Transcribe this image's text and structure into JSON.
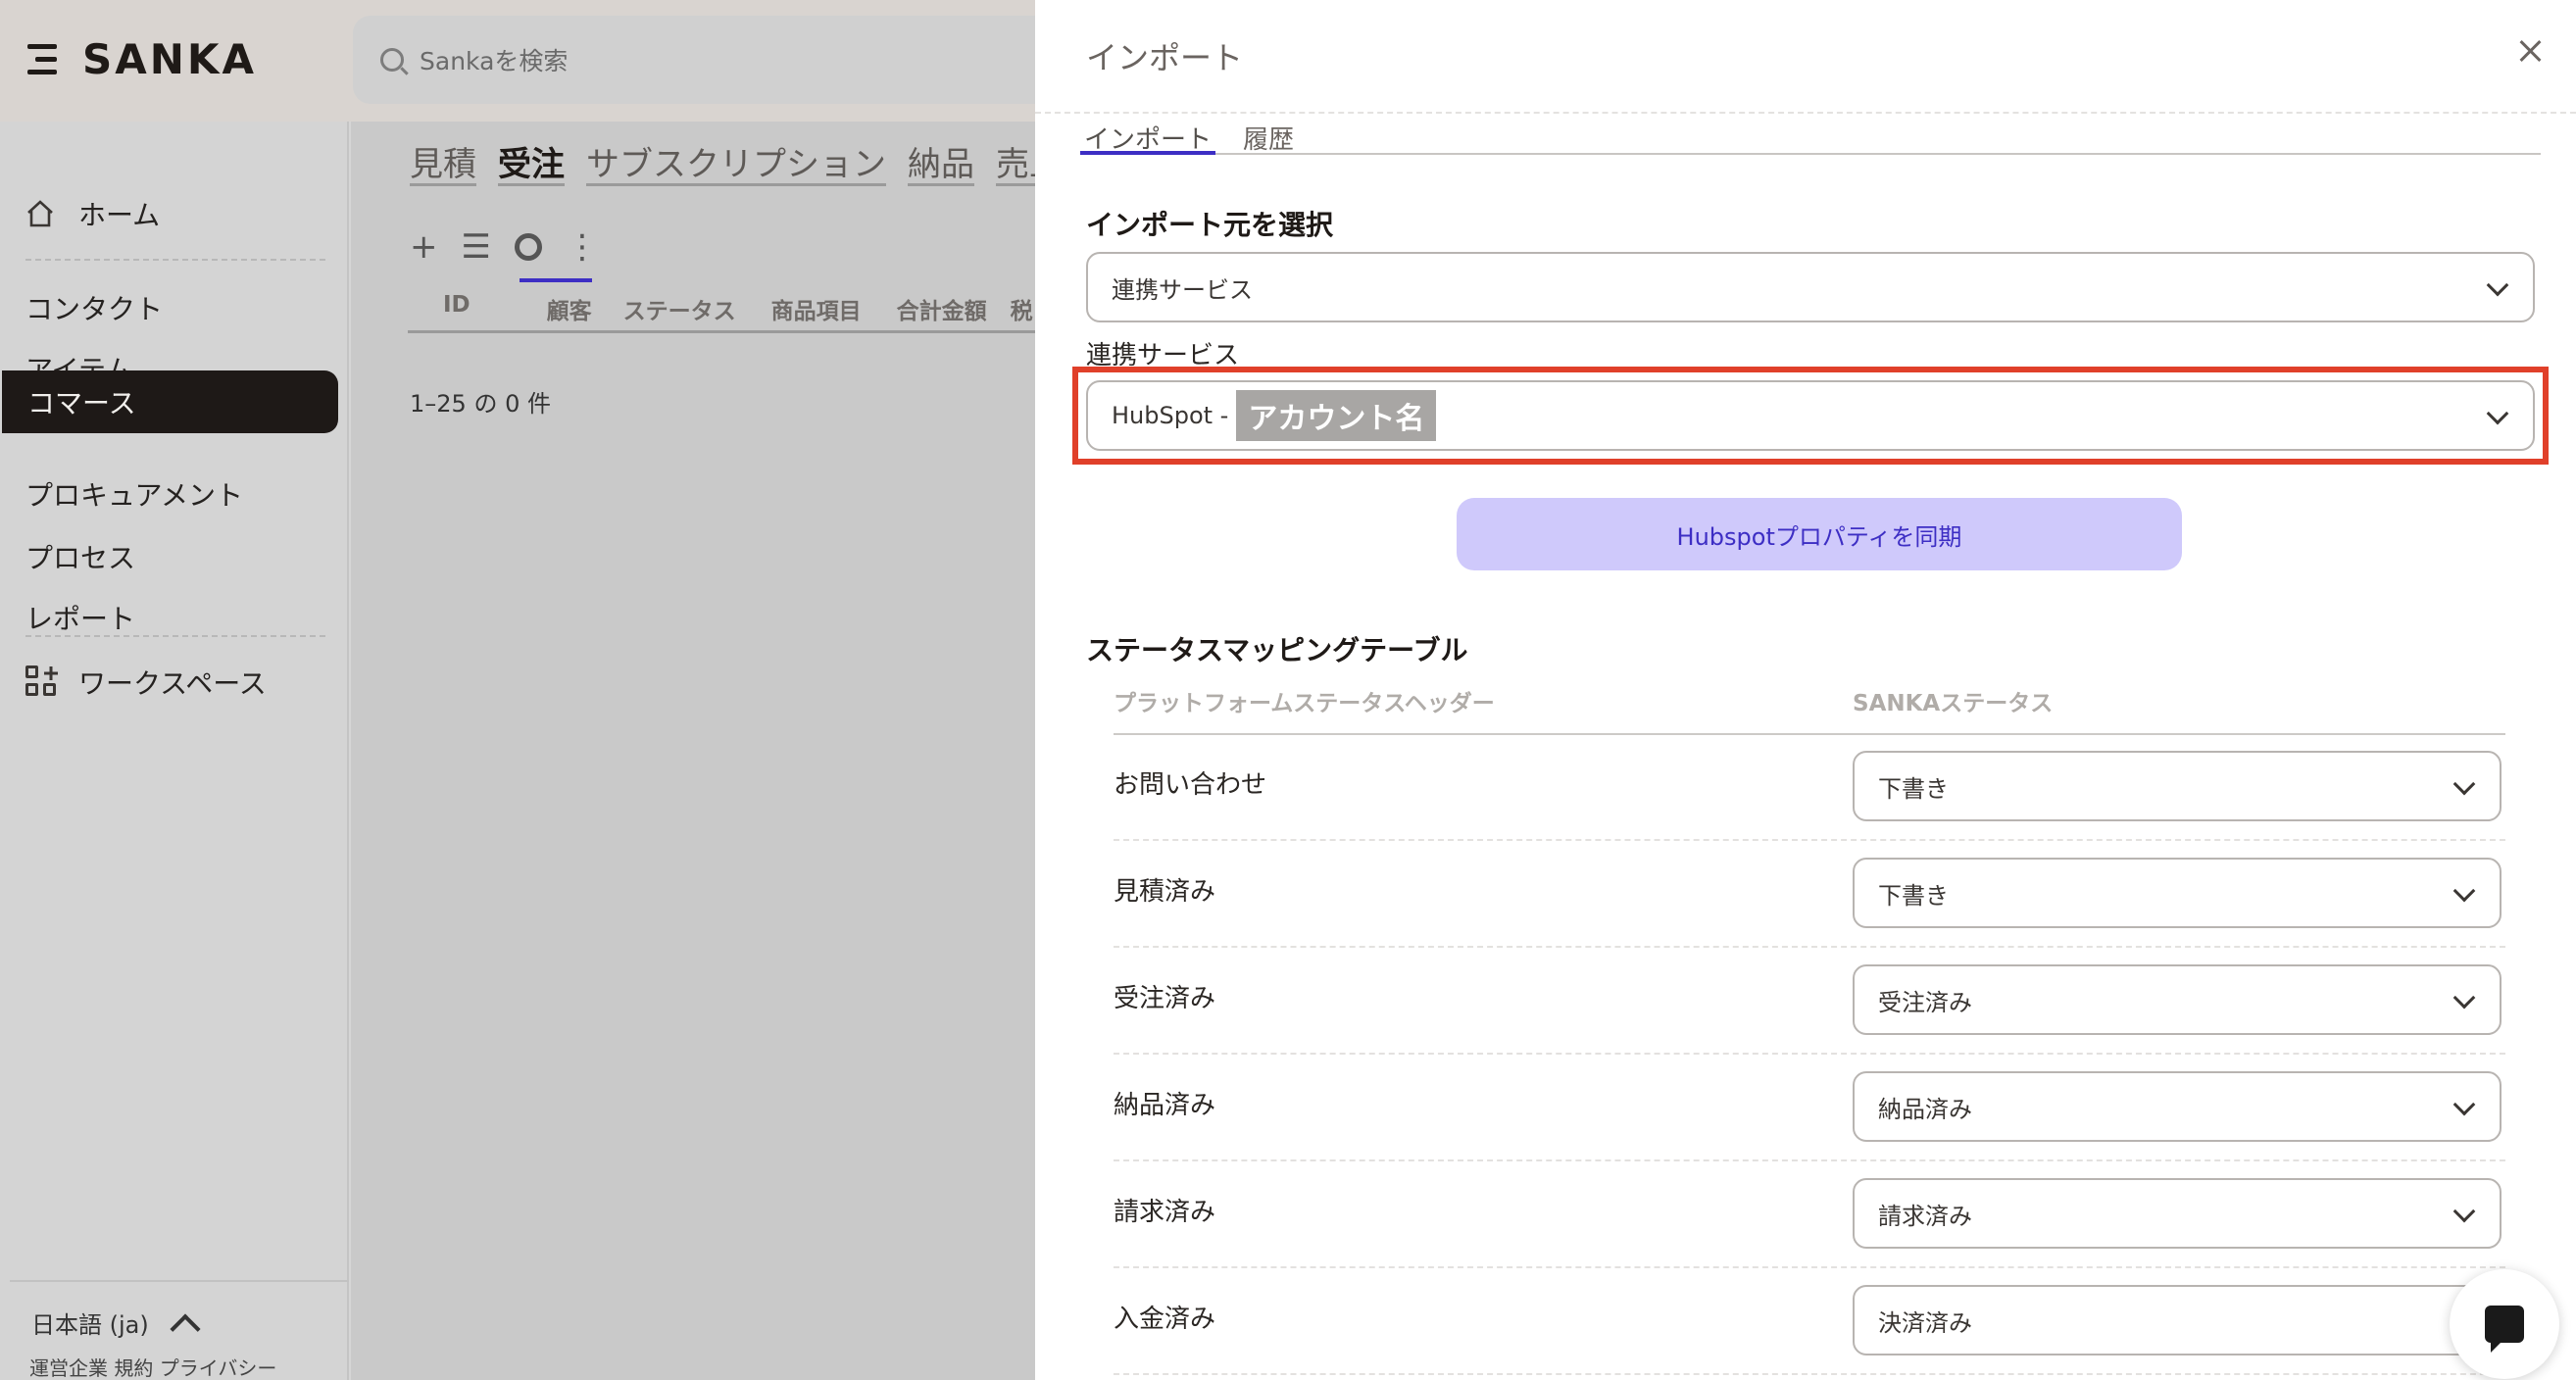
{
  "app": {
    "brand": "SANKA",
    "search_placeholder": "Sankaを検索"
  },
  "sidebar": {
    "items": [
      {
        "label": "ホーム"
      },
      {
        "label": "コンタクト"
      },
      {
        "label": "アイテム"
      },
      {
        "label": "コマース",
        "active": true
      },
      {
        "label": "プロキュアメント"
      },
      {
        "label": "プロセス"
      },
      {
        "label": "レポート"
      },
      {
        "label": "ワークスペース"
      }
    ],
    "language": "日本語 (ja)",
    "footer_links": "運営企業 規約 プライバシー"
  },
  "main": {
    "module_tabs": [
      "見積",
      "受注",
      "サブスクリプション",
      "納品",
      "売上"
    ],
    "active_module": "受注",
    "toolbar": {
      "add": "+",
      "list": "☰",
      "more": "⋮"
    },
    "columns": [
      "ID",
      "顧客",
      "ステータス",
      "商品項目",
      "合計金額",
      "税"
    ],
    "row_count": "1–25 の 0 件"
  },
  "panel": {
    "title": "インポート",
    "tabs": [
      "インポート",
      "履歴"
    ],
    "active_tab": "インポート",
    "source_section": "インポート元を選択",
    "source_value": "連携サービス",
    "integration_label": "連携サービス",
    "integration_prefix": "HubSpot -",
    "integration_account": "アカウント名",
    "sync_button": "Hubspotプロパティを同期",
    "mapping_title": "ステータスマッピングテーブル",
    "mapping_headers": {
      "platform": "プラットフォームステータスヘッダー",
      "sanka": "SANKAステータス"
    },
    "mapping_rows": [
      {
        "platform": "お問い合わせ",
        "sanka": "下書き"
      },
      {
        "platform": "見積済み",
        "sanka": "下書き"
      },
      {
        "platform": "受注済み",
        "sanka": "受注済み"
      },
      {
        "platform": "納品済み",
        "sanka": "納品済み"
      },
      {
        "platform": "請求済み",
        "sanka": "請求済み"
      },
      {
        "platform": "入金済み",
        "sanka": "決済済み"
      }
    ]
  },
  "colors": {
    "accent": "#3d2ec4",
    "highlight": "#e0402a",
    "sync_bg": "#cfc9fb"
  }
}
